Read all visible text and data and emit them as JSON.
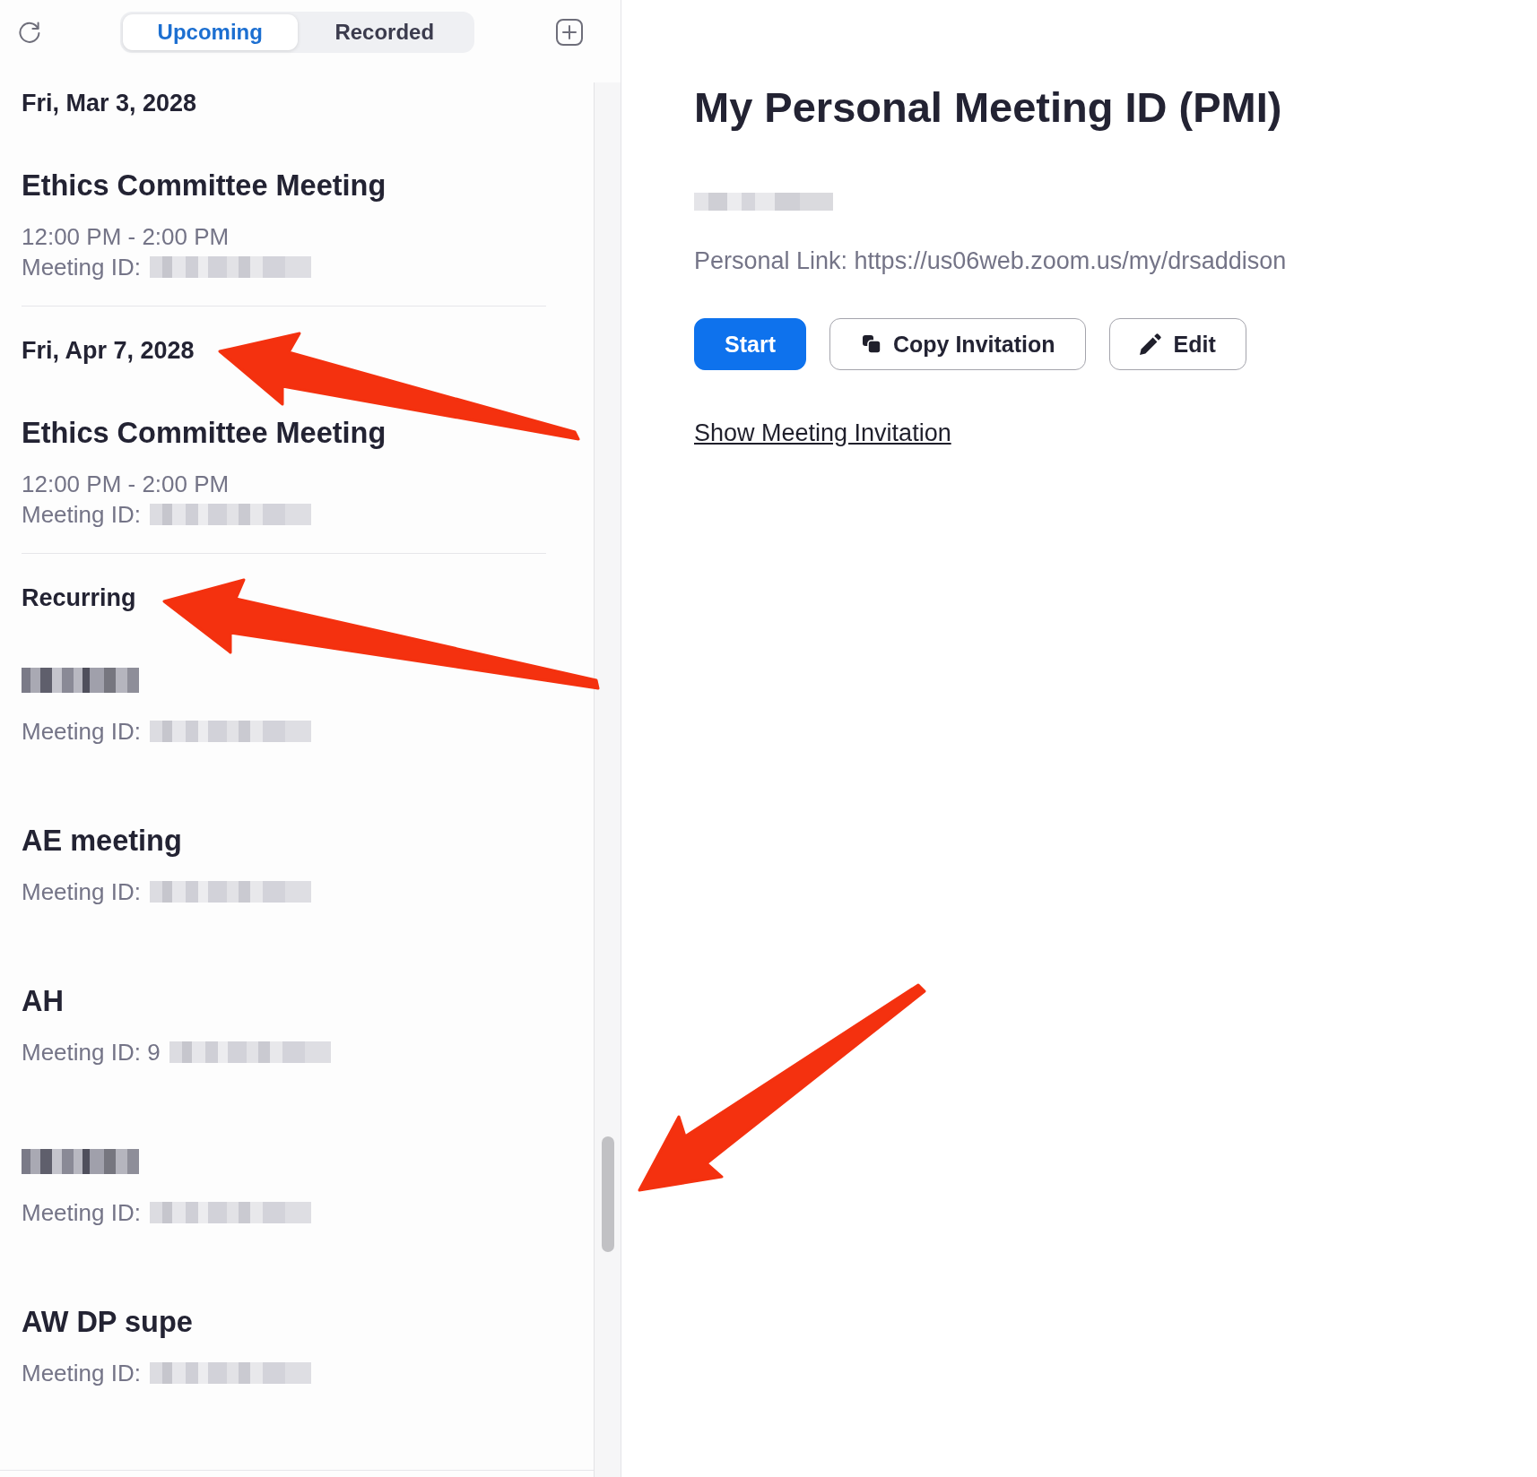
{
  "toolbar": {
    "tabs": [
      {
        "label": "Upcoming",
        "selected": true
      },
      {
        "label": "Recorded",
        "selected": false
      }
    ]
  },
  "meeting_list": {
    "groups": [
      {
        "heading": "Fri, Mar 3, 2028",
        "meetings": [
          {
            "title": "Ethics Committee Meeting",
            "title_redacted": false,
            "time": "12:00 PM - 2:00 PM",
            "meeting_id": "Meeting ID:",
            "id_redacted": true
          }
        ]
      },
      {
        "heading": "Fri, Apr 7, 2028",
        "meetings": [
          {
            "title": "Ethics Committee Meeting",
            "title_redacted": false,
            "time": "12:00 PM - 2:00 PM",
            "meeting_id": "Meeting ID:",
            "id_redacted": true
          }
        ]
      },
      {
        "heading": "Recurring",
        "meetings": [
          {
            "title_redacted": true,
            "meeting_id": "Meeting ID:",
            "id_redacted": true
          },
          {
            "title": "AE meeting",
            "title_redacted": false,
            "meeting_id": "Meeting ID:",
            "id_redacted": true
          },
          {
            "title": "AH",
            "title_redacted": false,
            "meeting_id": "Meeting ID: 9",
            "id_redacted": true
          },
          {
            "title_redacted": true,
            "meeting_id": "Meeting ID:",
            "id_redacted": true
          },
          {
            "title": "AW DP supe",
            "title_redacted": false,
            "meeting_id": "Meeting ID:",
            "id_redacted": true
          }
        ]
      }
    ]
  },
  "pmi_panel": {
    "title": "My Personal Meeting ID (PMI)",
    "meeting_id_redacted": true,
    "personal_link": "Personal Link: https://us06web.zoom.us/my/drsaddison",
    "buttons": [
      {
        "label": "Start",
        "kind": "start"
      },
      {
        "label": "Copy Invitation",
        "kind": "copy"
      },
      {
        "label": "Edit",
        "kind": "edit"
      }
    ],
    "link": "Show Meeting Invitation"
  },
  "annotations": [
    {
      "kind": "arrow"
    },
    {
      "kind": "arrow"
    },
    {
      "kind": "arrow"
    }
  ]
}
